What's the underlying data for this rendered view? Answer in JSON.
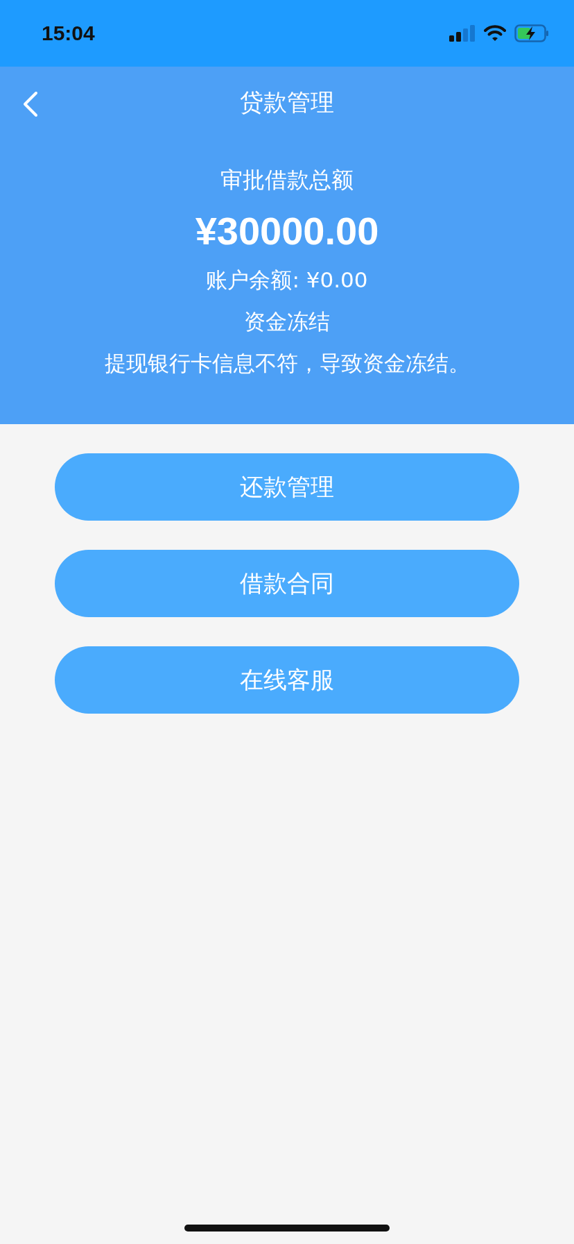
{
  "status_bar": {
    "time": "15:04"
  },
  "nav_bar": {
    "title": "贷款管理"
  },
  "summary": {
    "label": "审批借款总额",
    "amount": "¥30000.00",
    "balance": "账户余额: ¥0.00",
    "status": "资金冻结",
    "reason": "提现银行卡信息不符，导致资金冻结。"
  },
  "buttons": [
    {
      "label": "还款管理"
    },
    {
      "label": "借款合同"
    },
    {
      "label": "在线客服"
    }
  ]
}
